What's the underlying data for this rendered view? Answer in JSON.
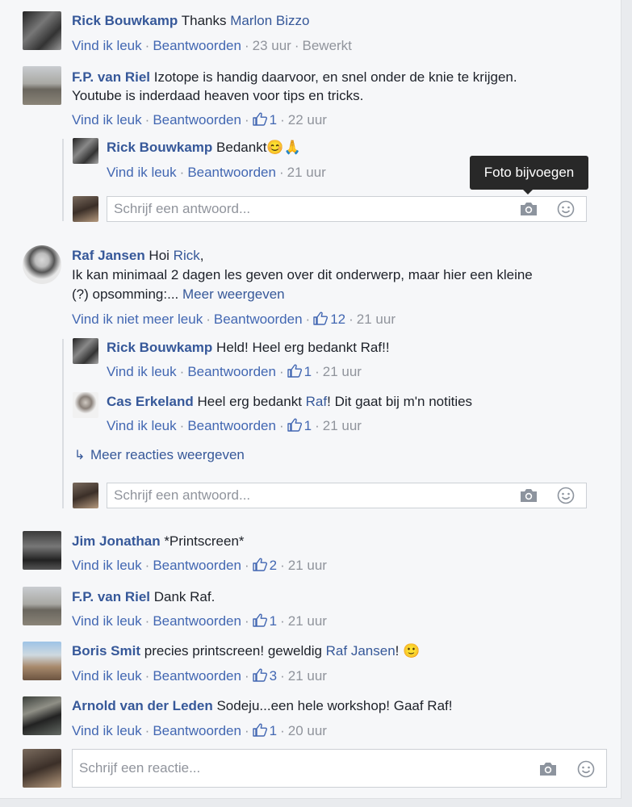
{
  "comments": [
    {
      "author": "Rick Bouwkamp",
      "text": " Thanks ",
      "mention": "Marlon Bizzo",
      "actions": {
        "like": "Vind ik leuk",
        "reply": "Beantwoorden",
        "time": "23 uur",
        "edited": "Bewerkt"
      }
    },
    {
      "author": "F.P. van Riel",
      "text": " Izotope is handig daarvoor, en snel onder de knie te krijgen.",
      "text2": "Youtube is inderdaad heaven voor tips en tricks.",
      "actions": {
        "like": "Vind ik leuk",
        "reply": "Beantwoorden",
        "likes": "1",
        "time": "22 uur"
      },
      "replies": [
        {
          "author": "Rick Bouwkamp",
          "text": " Bedankt",
          "emoji": "😊🙏",
          "actions": {
            "like": "Vind ik leuk",
            "reply": "Beantwoorden",
            "time": "21 uur"
          }
        }
      ],
      "reply_placeholder": "Schrijf een antwoord..."
    },
    {
      "author": "Raf Jansen",
      "text": " Hoi ",
      "mention": "Rick",
      "text_after_mention": ",",
      "text2": "Ik kan minimaal 2 dagen les geven over dit onderwerp, maar hier een kleine",
      "text3": "(?) opsomming:... ",
      "see_more": "Meer weergeven",
      "actions": {
        "like": "Vind ik niet meer leuk",
        "reply": "Beantwoorden",
        "likes": "12",
        "time": "21 uur"
      },
      "replies": [
        {
          "author": "Rick Bouwkamp",
          "text": " Held! Heel erg bedankt Raf!!",
          "actions": {
            "like": "Vind ik leuk",
            "reply": "Beantwoorden",
            "likes": "1",
            "time": "21 uur"
          }
        },
        {
          "author": "Cas Erkeland",
          "text": " Heel erg bedankt ",
          "mention": "Raf",
          "text_after_mention": "! Dit gaat bij m'n notities",
          "actions": {
            "like": "Vind ik leuk",
            "reply": "Beantwoorden",
            "likes": "1",
            "time": "21 uur"
          }
        }
      ],
      "more_replies": "Meer reacties weergeven",
      "reply_placeholder": "Schrijf een antwoord..."
    },
    {
      "author": "Jim Jonathan",
      "text": " *Printscreen*",
      "actions": {
        "like": "Vind ik leuk",
        "reply": "Beantwoorden",
        "likes": "2",
        "time": "21 uur"
      }
    },
    {
      "author": "F.P. van Riel",
      "text": " Dank Raf.",
      "actions": {
        "like": "Vind ik leuk",
        "reply": "Beantwoorden",
        "likes": "1",
        "time": "21 uur"
      }
    },
    {
      "author": "Boris Smit",
      "text": " precies printscreen! geweldig ",
      "mention": "Raf Jansen",
      "text_after_mention": "! ",
      "emoji": "🙂",
      "actions": {
        "like": "Vind ik leuk",
        "reply": "Beantwoorden",
        "likes": "3",
        "time": "21 uur"
      }
    },
    {
      "author": "Arnold van der Leden",
      "text": " Sodeju...een hele workshop! Gaaf Raf!",
      "actions": {
        "like": "Vind ik leuk",
        "reply": "Beantwoorden",
        "likes": "1",
        "time": "20 uur"
      }
    }
  ],
  "tooltip": "Foto bijvoegen",
  "comment_placeholder": "Schrijf een reactie...",
  "icons": {
    "camera": "camera-icon",
    "emoji": "emoji-icon",
    "like": "thumbs-up-icon",
    "reply_arrow": "reply-arrow-icon"
  },
  "colors": {
    "link": "#365899",
    "action": "#4267b2",
    "muted": "#90949c",
    "background": "#f6f7f9"
  }
}
